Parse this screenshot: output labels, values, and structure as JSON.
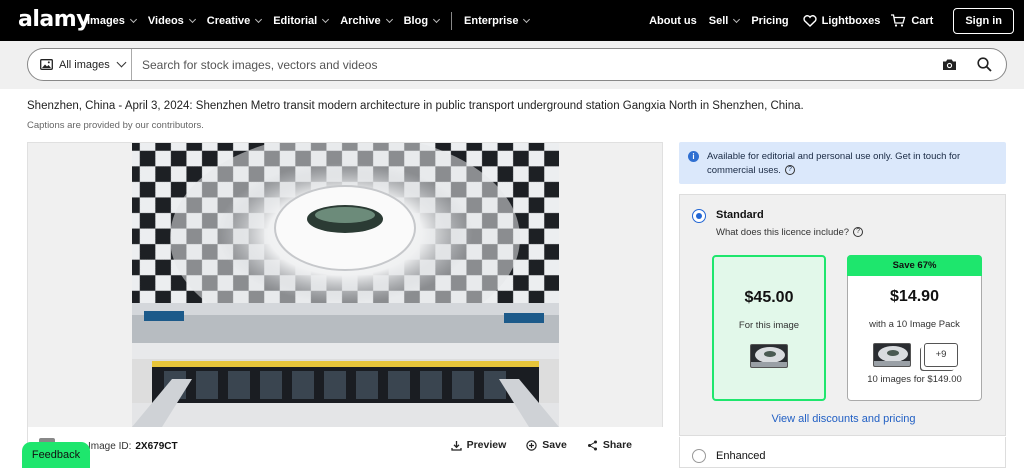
{
  "brand": {
    "logo": "alamy"
  },
  "nav": {
    "left": [
      {
        "label": "Images",
        "chevron": true
      },
      {
        "label": "Videos",
        "chevron": true
      },
      {
        "label": "Creative",
        "chevron": true
      },
      {
        "label": "Editorial",
        "chevron": true
      },
      {
        "label": "Archive",
        "chevron": true
      },
      {
        "label": "Blog",
        "chevron": true
      },
      {
        "label": "Enterprise",
        "chevron": true
      }
    ],
    "right": {
      "about": "About us",
      "sell": "Sell",
      "pricing": "Pricing",
      "lightboxes": "Lightboxes",
      "cart": "Cart",
      "signin": "Sign in"
    }
  },
  "search": {
    "scope": "All images",
    "placeholder": "Search for stock images, vectors and videos"
  },
  "image": {
    "caption": "Shenzhen, China - April 3, 2024: Shenzhen Metro transit modern architecture in public transport underground station Gangxia North in Shenzhen, China.",
    "caption_note": "Captions are provided by our contributors.",
    "id_label": "Image ID:",
    "id_value": "2X679CT",
    "actions": {
      "preview": "Preview",
      "save": "Save",
      "share": "Share"
    }
  },
  "feedback": "Feedback",
  "licence": {
    "info": "Available for editorial and personal use only. Get in touch for commercial uses.",
    "standard": {
      "label": "Standard",
      "question": "What does this licence include?",
      "single": {
        "price": "$45.00",
        "text": "For this image"
      },
      "pack": {
        "badge": "Save 67%",
        "price": "$14.90",
        "text": "with a 10 Image Pack",
        "plus": "+9",
        "footnote": "10 images for $149.00"
      }
    },
    "view_all": "View all discounts and pricing",
    "enhanced": {
      "label": "Enhanced"
    }
  },
  "colors": {
    "accent_green": "#1ee66d",
    "link_blue": "#2260c4",
    "info_bg": "#dbe8fb",
    "nav_bg": "#000000"
  }
}
